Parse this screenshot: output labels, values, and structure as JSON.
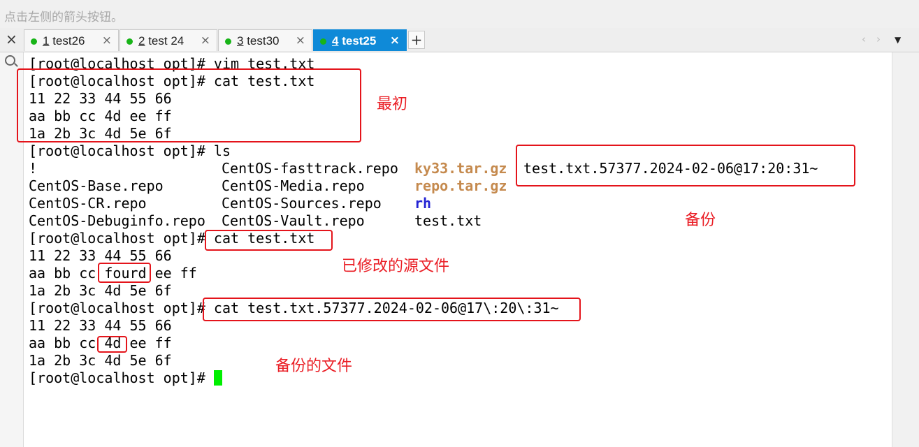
{
  "hint": "点击左侧的箭头按钮。",
  "tabs": [
    {
      "num": "1",
      "name": "test26",
      "close": "×"
    },
    {
      "num": "2",
      "name": "test 24",
      "close": "×"
    },
    {
      "num": "3",
      "name": "test30",
      "close": "×"
    },
    {
      "num": "4",
      "name": "test25",
      "close": "×",
      "active": true
    }
  ],
  "toolbar": {
    "side_close": "×",
    "new_tab": "+",
    "nav_left": "‹",
    "nav_right": "›",
    "menu": "▼"
  },
  "colors": {
    "tab_active": "#0f8ad8",
    "tab_dot": "#18b418",
    "annotation": "#e4141b",
    "archive": "#c58a4e",
    "dir": "#2424d4",
    "cursor": "#00ef00"
  },
  "terminal": {
    "l1": "[root@localhost opt]# vim test.txt",
    "l2": "[root@localhost opt]# cat test.txt",
    "l3": "11 22 33 44 55 66",
    "l4": "aa bb cc 4d ee ff",
    "l5": "1a 2b 3c 4d 5e 6f",
    "l6": "[root@localhost opt]# ls",
    "ls": {
      "r1": {
        "c1": "!",
        "c2": "CentOS-fasttrack.repo",
        "c3": "ky33.tar.gz",
        "c4": "test.txt.57377.2024-02-06@17:20:31~"
      },
      "r2": {
        "c1": "CentOS-Base.repo",
        "c2": "CentOS-Media.repo",
        "c3": "repo.tar.gz"
      },
      "r3": {
        "c1": "CentOS-CR.repo",
        "c2": "CentOS-Sources.repo",
        "c3": "rh"
      },
      "r4": {
        "c1": "CentOS-Debuginfo.repo",
        "c2": "CentOS-Vault.repo",
        "c3": "test.txt"
      }
    },
    "l11": "[root@localhost opt]# cat test.txt",
    "l12": "11 22 33 44 55 66",
    "l13": "aa bb cc fourd ee ff",
    "l14": "1a 2b 3c 4d 5e 6f",
    "l15": "[root@localhost opt]# cat test.txt.57377.2024-02-06@17\\:20\\:31~",
    "l16": "11 22 33 44 55 66",
    "l17": "aa bb cc 4d ee ff",
    "l18": "1a 2b 3c 4d 5e 6f",
    "prompt": "[root@localhost opt]# "
  },
  "annotations": {
    "initial": "最初",
    "backup": "备份",
    "modified": "已修改的源文件",
    "backup_file": "备份的文件"
  }
}
